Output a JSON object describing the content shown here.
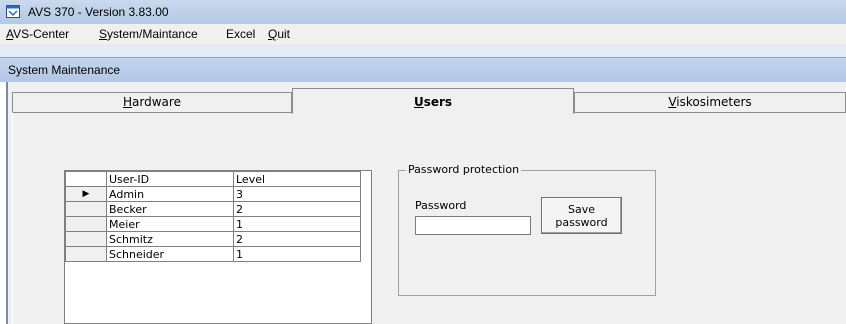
{
  "window": {
    "title": "AVS 370 - Version 3.83.00"
  },
  "menu": [
    {
      "label": "AVS-Center",
      "mnemonic": "A"
    },
    {
      "label": "System/Maintance",
      "mnemonic": "S"
    },
    {
      "label": "Excel",
      "mnemonic": ""
    },
    {
      "label": "Quit",
      "mnemonic": "Q"
    }
  ],
  "dialog": {
    "title": "System Maintenance"
  },
  "tabs": [
    {
      "label": "Hardware",
      "active": false
    },
    {
      "label": "Users",
      "active": true
    },
    {
      "label": "Viskosimeters",
      "active": false
    }
  ],
  "users_grid": {
    "headers": [
      "User-ID",
      "Level"
    ],
    "current_row_indicator": "▶",
    "rows": [
      {
        "user_id": "Admin",
        "level": "3"
      },
      {
        "user_id": "Becker",
        "level": "2"
      },
      {
        "user_id": "Meier",
        "level": "1"
      },
      {
        "user_id": "Schmitz",
        "level": "2"
      },
      {
        "user_id": "Schneider",
        "level": "1"
      }
    ]
  },
  "password_protection": {
    "legend": "Password protection",
    "password_label": "Password",
    "password_value": "",
    "save_button_line1": "Save",
    "save_button_line2": "password"
  },
  "colors": {
    "titlebar": "#b9cde6",
    "client_bg": "#f0f0f0",
    "grid_bg": "#ffffff"
  }
}
